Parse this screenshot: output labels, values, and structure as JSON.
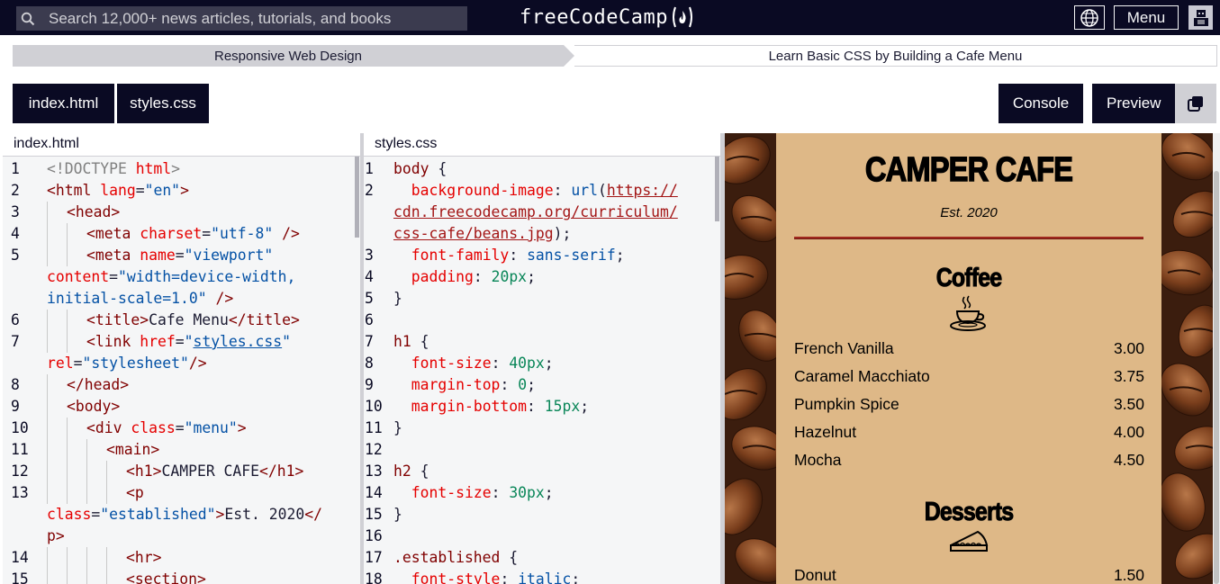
{
  "nav": {
    "search_placeholder": "Search 12,000+ news articles, tutorials, and books",
    "brand": "freeCodeCamp",
    "menu_label": "Menu"
  },
  "breadcrumb": {
    "course": "Responsive Web Design",
    "project": "Learn Basic CSS by Building a Cafe Menu"
  },
  "tabs": {
    "index": "index.html",
    "styles": "styles.css",
    "console": "Console",
    "preview": "Preview"
  },
  "editors": {
    "html_title": "index.html",
    "css_title": "styles.css"
  },
  "preview": {
    "title": "CAMPER CAFE",
    "established": "Est. 2020",
    "coffee_heading": "Coffee",
    "desserts_heading": "Desserts",
    "coffee": [
      {
        "name": "French Vanilla",
        "price": "3.00"
      },
      {
        "name": "Caramel Macchiato",
        "price": "3.75"
      },
      {
        "name": "Pumpkin Spice",
        "price": "3.50"
      },
      {
        "name": "Hazelnut",
        "price": "4.00"
      },
      {
        "name": "Mocha",
        "price": "4.50"
      }
    ],
    "desserts": [
      {
        "name": "Donut",
        "price": "1.50"
      }
    ]
  },
  "colors": {
    "nav_bg": "#0a0a23",
    "menu_bg": "#deb887",
    "hr": "#a0281e"
  }
}
